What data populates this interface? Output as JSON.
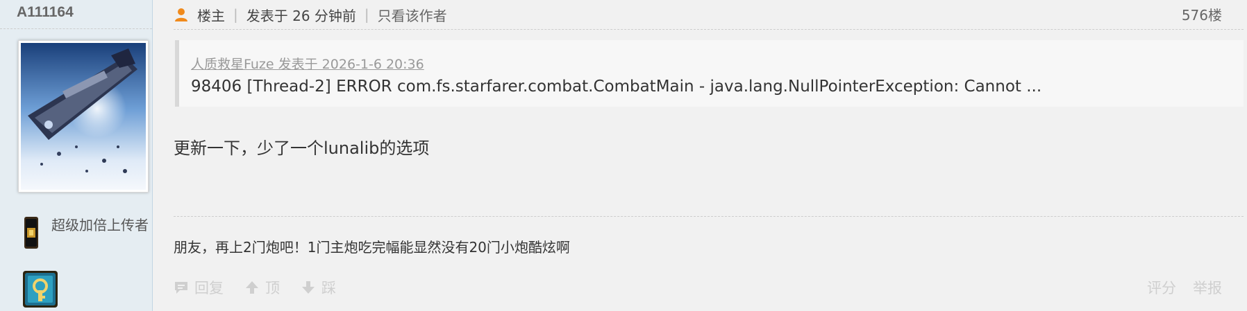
{
  "author": {
    "username": "A111164",
    "badge_label": "超级加倍上传者"
  },
  "post": {
    "role": "楼主",
    "posted": "发表于 26 分钟前",
    "only_author": "只看该作者",
    "floor": "576楼",
    "quote": {
      "by": "人质救星Fuze 发表于 2026-1-6 20:36",
      "text": "98406 [Thread-2] ERROR com.fs.starfarer.combat.CombatMain  - java.lang.NullPointerException: Cannot  ..."
    },
    "body": "更新一下，少了一个lunalib的选项",
    "signature": "朋友，再上2门炮吧！1门主炮吃完幅能显然没有20门小炮酷炫啊"
  },
  "actions": {
    "reply": "回复",
    "up": "顶",
    "down": "踩",
    "rate": "评分",
    "report": "举报"
  },
  "colors": {
    "sidebar_bg": "#e5edf2",
    "main_bg": "#f1f1f1",
    "user_icon": "#f08a1c",
    "action_muted": "#cfcfcf"
  },
  "icons": {
    "role": "user-icon",
    "reply": "comment-icon",
    "up": "arrow-up-icon",
    "down": "arrow-down-icon"
  }
}
